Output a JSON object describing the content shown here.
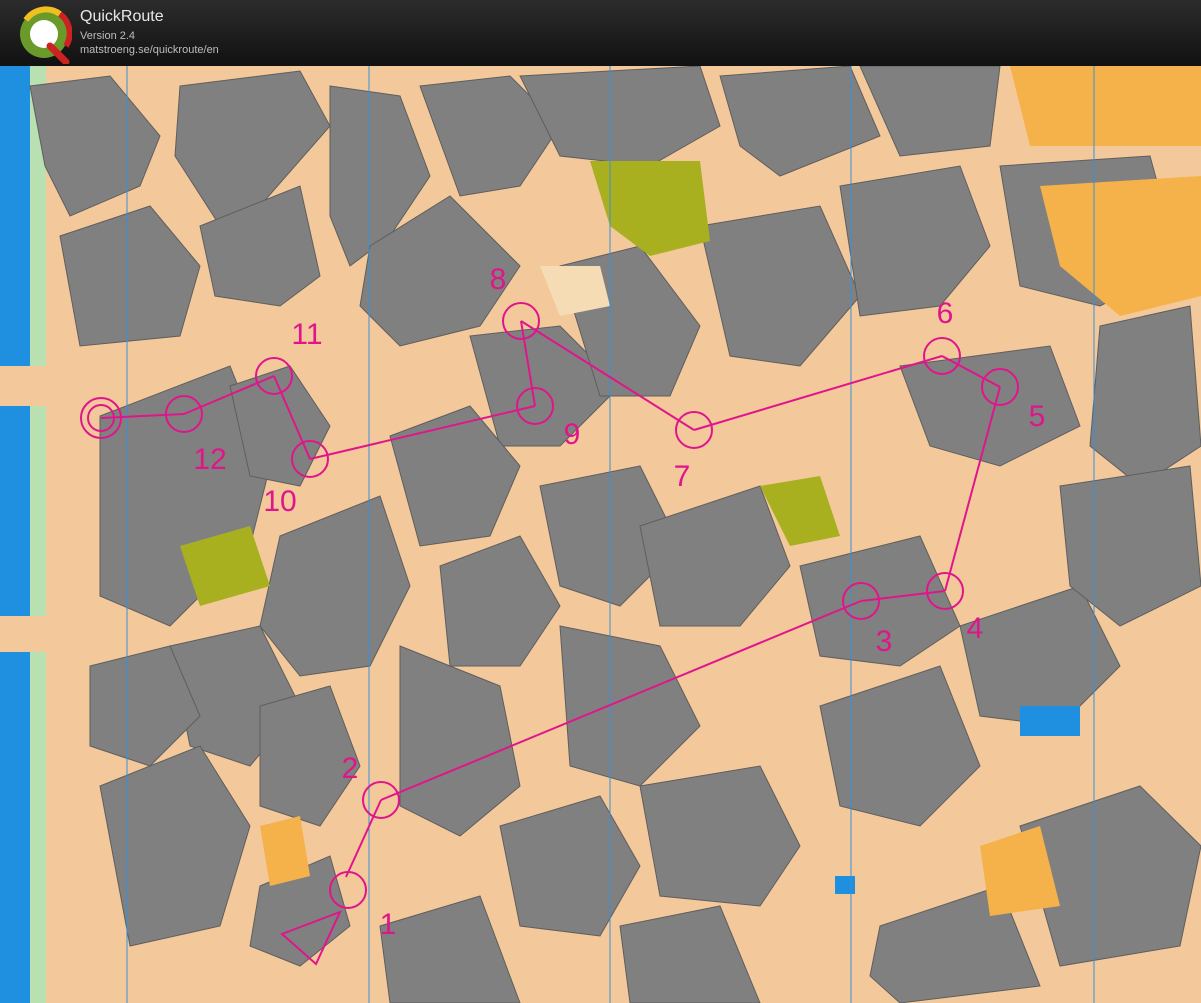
{
  "app": {
    "name": "QuickRoute",
    "version": "Version 2.4",
    "url": "matstroeng.se/quickroute/en"
  },
  "colors": {
    "course": "#e0158c",
    "building": "#808080",
    "street": "#f3c89b",
    "water": "#1f8fe0",
    "olive": "#a8b020",
    "open_land": "#f6b24a",
    "magnetic_line": "#3a8fd6"
  },
  "icons": [
    "quickroute-logo-icon"
  ],
  "course": {
    "controls": [
      {
        "label": "1"
      },
      {
        "label": "2"
      },
      {
        "label": "3"
      },
      {
        "label": "4"
      },
      {
        "label": "5"
      },
      {
        "label": "6"
      },
      {
        "label": "7"
      },
      {
        "label": "8"
      },
      {
        "label": "9"
      },
      {
        "label": "10"
      },
      {
        "label": "11"
      },
      {
        "label": "12"
      }
    ]
  }
}
